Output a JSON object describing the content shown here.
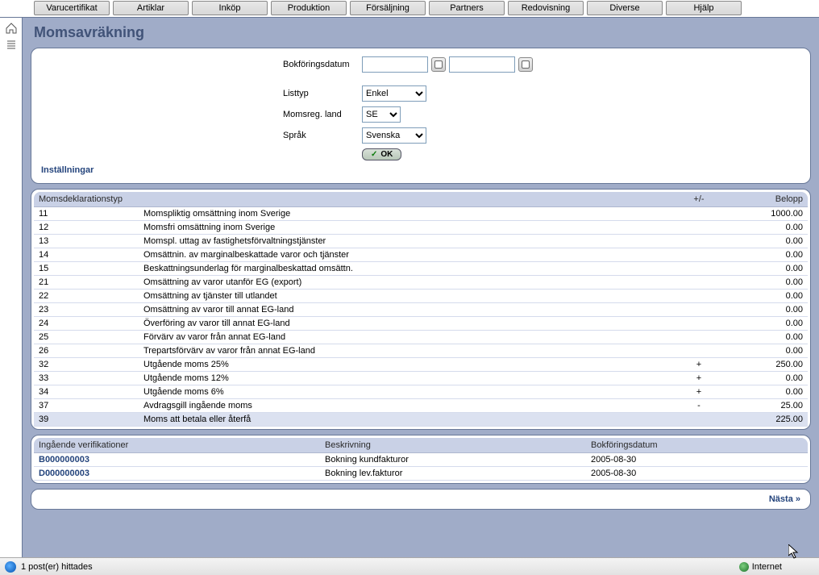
{
  "topmenu": [
    "Varucertifikat",
    "Artiklar",
    "Inköp",
    "Produktion",
    "Försäljning",
    "Partners",
    "Redovisning",
    "Diverse",
    "Hjälp"
  ],
  "title": "Momsavräkning",
  "form": {
    "bokforingsdatum_label": "Bokföringsdatum",
    "date_from": "",
    "date_to": "",
    "listtyp_label": "Listtyp",
    "listtyp_value": "Enkel",
    "momsreg_label": "Momsreg. land",
    "momsreg_value": "SE",
    "sprak_label": "Språk",
    "sprak_value": "Svenska",
    "ok_label": "OK",
    "settings_link": "Inställningar"
  },
  "table1": {
    "headers": {
      "typ": "Momsdeklarationstyp",
      "pm": "+/-",
      "belopp": "Belopp"
    },
    "rows": [
      {
        "code": "11",
        "desc": "Momspliktig omsättning inom Sverige",
        "pm": "",
        "amt": "1000.00"
      },
      {
        "code": "12",
        "desc": "Momsfri omsättning inom Sverige",
        "pm": "",
        "amt": "0.00"
      },
      {
        "code": "13",
        "desc": "Momspl. uttag av fastighetsförvaltningstjänster",
        "pm": "",
        "amt": "0.00"
      },
      {
        "code": "14",
        "desc": "Omsättnin. av marginalbeskattade varor och tjänster",
        "pm": "",
        "amt": "0.00"
      },
      {
        "code": "15",
        "desc": "Beskattningsunderlag för marginalbeskattad omsättn.",
        "pm": "",
        "amt": "0.00"
      },
      {
        "code": "21",
        "desc": "Omsättning av varor utanför EG (export)",
        "pm": "",
        "amt": "0.00"
      },
      {
        "code": "22",
        "desc": "Omsättning av tjänster till utlandet",
        "pm": "",
        "amt": "0.00"
      },
      {
        "code": "23",
        "desc": "Omsättning av varor till annat EG-land",
        "pm": "",
        "amt": "0.00"
      },
      {
        "code": "24",
        "desc": "Överföring av varor till annat EG-land",
        "pm": "",
        "amt": "0.00"
      },
      {
        "code": "25",
        "desc": "Förvärv av varor från annat EG-land",
        "pm": "",
        "amt": "0.00"
      },
      {
        "code": "26",
        "desc": "Trepartsförvärv av varor från annat EG-land",
        "pm": "",
        "amt": "0.00"
      },
      {
        "code": "32",
        "desc": "Utgående moms 25%",
        "pm": "+",
        "amt": "250.00"
      },
      {
        "code": "33",
        "desc": "Utgående moms 12%",
        "pm": "+",
        "amt": "0.00"
      },
      {
        "code": "34",
        "desc": "Utgående moms 6%",
        "pm": "+",
        "amt": "0.00"
      },
      {
        "code": "37",
        "desc": "Avdragsgill ingående moms",
        "pm": "-",
        "amt": "25.00"
      },
      {
        "code": "39",
        "desc": "Moms att betala eller återfå",
        "pm": "",
        "amt": "225.00",
        "hl": true
      }
    ]
  },
  "table2": {
    "headers": {
      "ver": "Ingående verifikationer",
      "besk": "Beskrivning",
      "bok": "Bokföringsdatum"
    },
    "rows": [
      {
        "ver": "B000000003",
        "besk": "Bokning kundfakturor",
        "bok": "2005-08-30"
      },
      {
        "ver": "D000000003",
        "besk": "Bokning lev.fakturor",
        "bok": "2005-08-30"
      }
    ]
  },
  "next_label": "Nästa »",
  "status": {
    "msg": "1 post(er) hittades",
    "zone": "Internet"
  }
}
